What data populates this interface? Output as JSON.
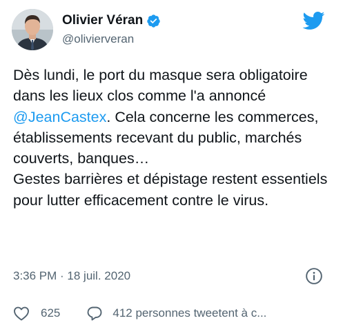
{
  "author": {
    "display_name": "Olivier Véran",
    "handle": "@olivierveran",
    "verified": true,
    "avatar_icon": "profile-photo"
  },
  "tweet": {
    "text_before": "Dès lundi, le port du masque sera obligatoire dans les lieux clos comme l'a annoncé ",
    "mention": "@JeanCastex",
    "text_after": ". Cela concerne les commerces, établissements recevant du public, marchés couverts, banques…\nGestes barrières et dépistage restent essentiels pour lutter efficacement contre le virus."
  },
  "meta": {
    "timestamp": "3:36 PM · 18 juil. 2020"
  },
  "actions": {
    "like_count": "625",
    "reply_text": "412 personnes tweetent à c..."
  },
  "colors": {
    "brand": "#1d9bf0",
    "text": "#0f1419",
    "muted": "#536471"
  },
  "icons": {
    "logo": "twitter-bird-icon",
    "verified": "verified-badge-icon",
    "info": "info-icon",
    "like": "heart-icon",
    "reply": "speech-bubble-icon"
  }
}
